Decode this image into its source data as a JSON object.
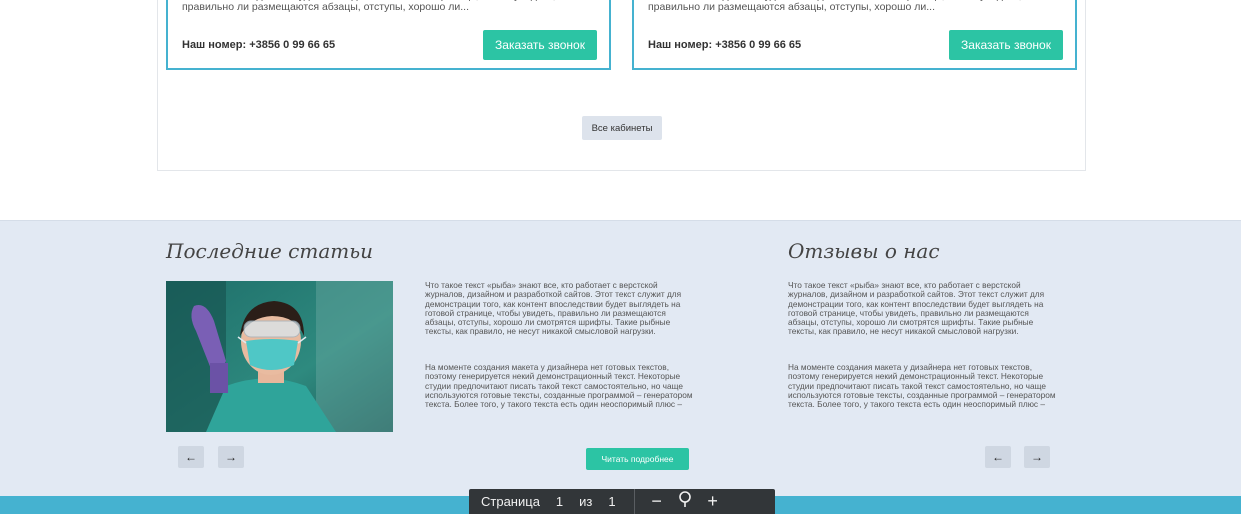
{
  "cards": [
    {
      "text": "дизайном и разработкой сайтов. Этот текст служит для демонстрации того, как контент впоследствии будет выглядеть на готовой странице, чтобы увидеть, правильно ли размещаются абзацы, отступы, хорошо ли...",
      "phone": "Наш номер: +3856 0 99 66 65",
      "button": "Заказать звонок"
    },
    {
      "text": "дизайном и разработкой сайтов. Этот текст служит для демонстрации того, как контент впоследствии будет выглядеть на готовой странице, чтобы увидеть, правильно ли размещаются абзацы, отступы, хорошо ли...",
      "phone": "Наш номер: +3856 0 99 66 65",
      "button": "Заказать звонок"
    }
  ],
  "all_cabinets": "Все кабинеты",
  "articles": {
    "title": "Последние статьи",
    "para1": "Что такое текст «рыба» знают все, кто работает с верстской журналов, дизайном и разработкой сайтов. Этот текст служит для демонстрации того, как контент впоследствии будет выглядеть на готовой странице, чтобы увидеть, правильно ли размещаются абзацы, отступы, хорошо ли смотрятся шрифты. Такие рыбные тексты, как правило, не несут никакой смысловой нагрузки.",
    "para2": "На моменте создания макета у дизайнера нет готовых текстов, поэтому генерируется некий демонстрационный текст. Некоторые студии предпочитают писать такой текст самостоятельно, но чаще используются готовые тексты, созданные программой – генератором текста. Более того, у такого текста есть один неоспоримый плюс –",
    "read_more": "Читать подробнее",
    "prev": "←",
    "next": "→"
  },
  "reviews": {
    "title": "Отзывы о нас",
    "para1": "Что такое текст «рыба» знают все, кто работает с верстской журналов, дизайном и разработкой сайтов. Этот текст служит для демонстрации того, как контент впоследствии будет выглядеть на готовой странице, чтобы увидеть, правильно ли размещаются абзацы, отступы, хорошо ли смотрятся шрифты. Такие рыбные тексты, как правило, не несут никакой смысловой нагрузки.",
    "para2": "На моменте создания макета у дизайнера нет готовых текстов, поэтому генерируется некий демонстрационный текст. Некоторые студии предпочитают писать такой текст самостоятельно, но чаще используются готовые тексты, созданные программой – генератором текста. Более того, у такого текста есть один неоспоримый плюс –",
    "prev": "←",
    "next": "→"
  },
  "pdf_toolbar": {
    "page_label": "Страница",
    "page_current": "1",
    "of_label": "из",
    "page_total": "1",
    "zoom_out": "−",
    "zoom_reset_icon": "magnifier-icon",
    "zoom_in": "+"
  },
  "colors": {
    "accent_teal": "#2cc4a4",
    "card_border": "#45b2d0",
    "footer_bg": "#e2e9f3",
    "toolbar_bg": "#323639"
  }
}
